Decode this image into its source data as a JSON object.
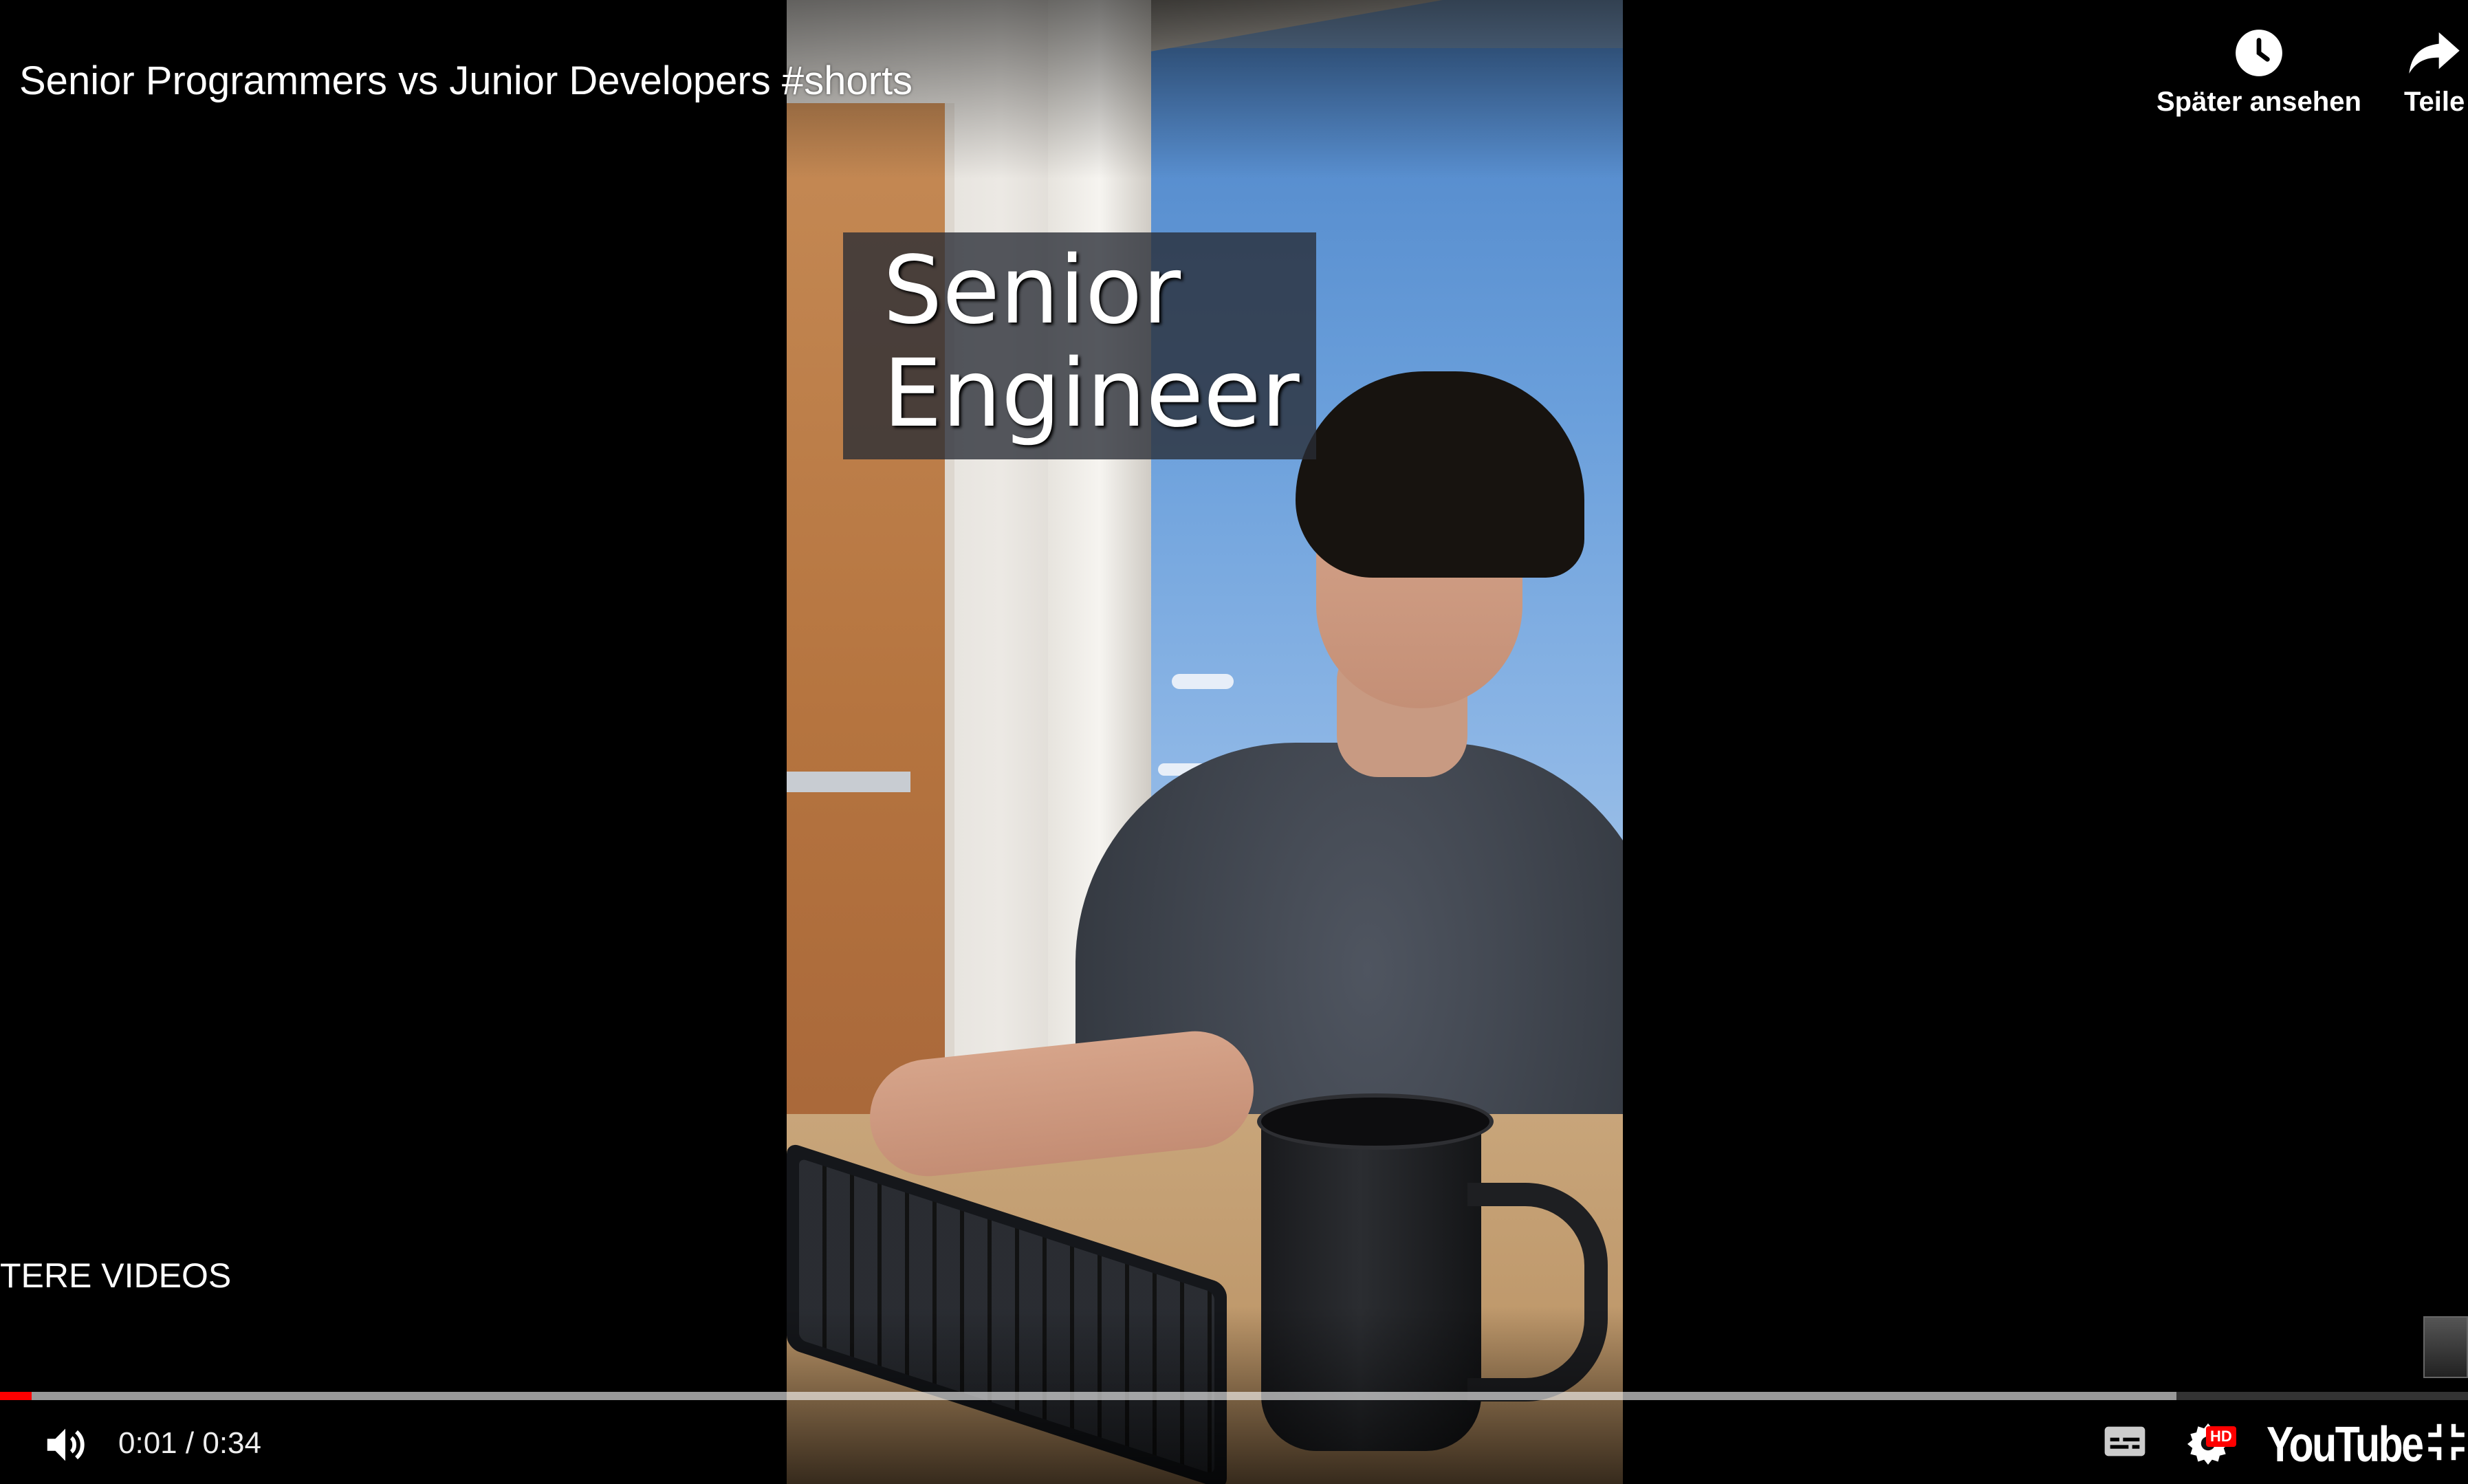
{
  "video": {
    "title": "Senior Programmers vs Junior Developers #shorts",
    "overlay_caption": [
      "Senior",
      "Engineer"
    ]
  },
  "top_actions": {
    "watch_later_label": "Später ansehen",
    "share_label": "Teile"
  },
  "more_videos_label": "TERE VIDEOS",
  "player": {
    "current_time": "0:01",
    "separator": "/",
    "duration": "0:34",
    "played_fraction": 0.006,
    "loaded_fraction": 0.882,
    "hd_badge": "HD",
    "logo_text": "YouTube",
    "progress_color": "#ff0000"
  },
  "icons": [
    "clock-icon",
    "share-arrow-icon",
    "volume-icon",
    "subtitles-icon",
    "settings-gear-icon",
    "exit-fullscreen-icon"
  ]
}
